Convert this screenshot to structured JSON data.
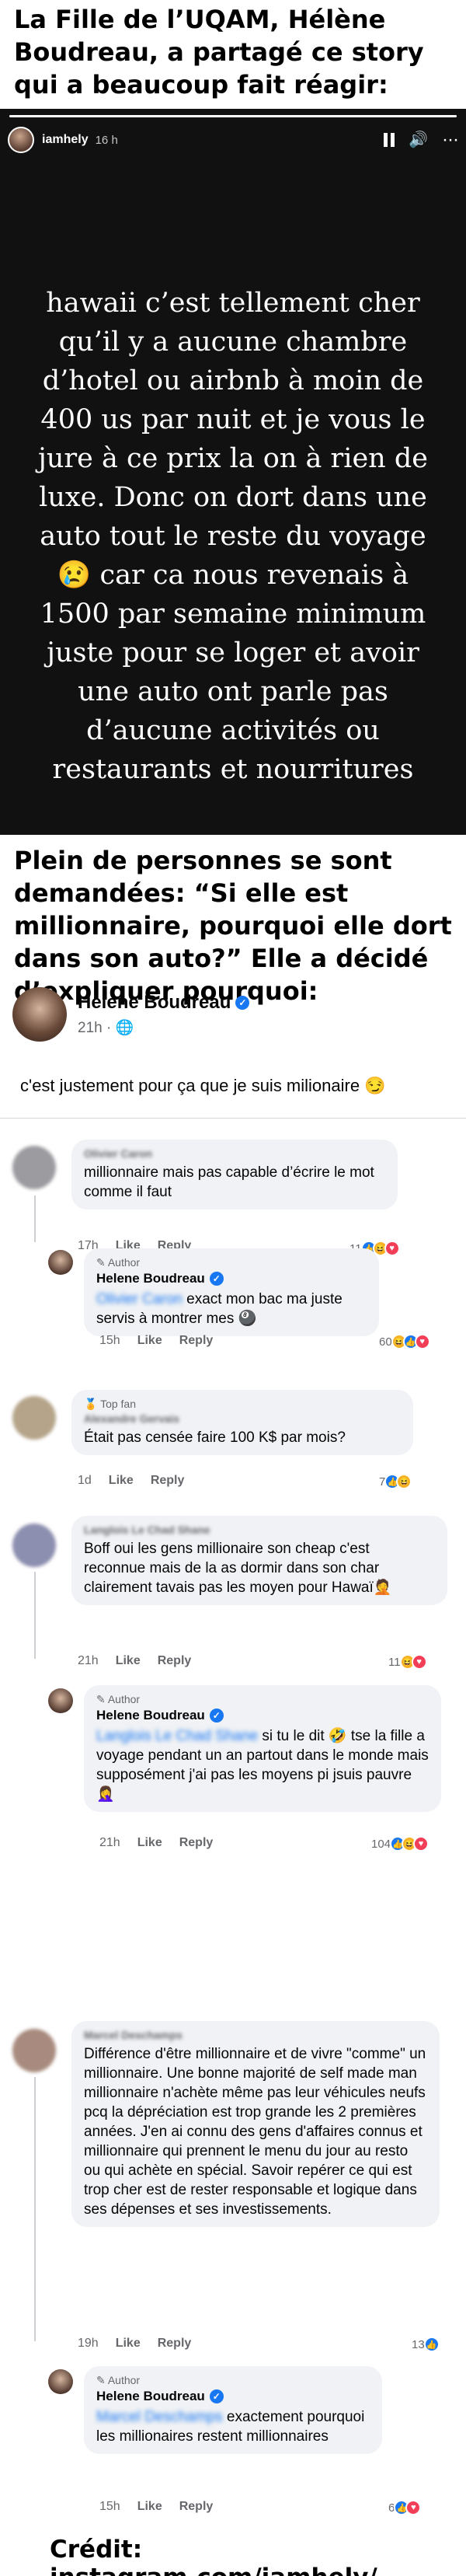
{
  "headline_top": "La Fille de l’UQAM, Hélène Boudreau, a partagé ce story qui a beaucoup fait réagir:",
  "story": {
    "username": "iamhely",
    "time": "16 h",
    "text": "hawaii c’est tellement cher qu’il y a aucune chambre d’hotel ou airbnb à moin de 400 us par nuit et je vous le jure à ce prix la on à rien de luxe. Donc on dort dans une auto tout le reste du voyage 😢 car ca nous revenais à 1500 par semaine minimum juste pour se loger et avoir une auto ont parle pas d’aucune activités ou restaurants et nourritures"
  },
  "headline_mid": "Plein de personnes se sont demandées: “Si elle est millionnaire, pourquoi elle dort dans son auto?” Elle a décidé d’expliquer pourquoi:",
  "post": {
    "author": "Helene Boudreau",
    "time": "21h",
    "separator": "·",
    "globe": "🌐",
    "text": "c'est justement pour ça que je suis milionaire 😏"
  },
  "labels": {
    "like": "Like",
    "reply": "Reply",
    "author_tag": "✎ Author",
    "top_fan": "🏅 Top fan"
  },
  "comments": [
    {
      "name": "Olivier Caron",
      "text": "millionnaire mais pas capable d’écrire le mot comme il faut",
      "time": "17h",
      "count": "11",
      "reply": {
        "name": "Helene Boudreau",
        "mention": "Olivier Caron",
        "text": "exact mon bac ma juste servis à montrer mes 🎱",
        "time": "15h",
        "count": "60"
      }
    },
    {
      "name": "Alexandre Gervais",
      "text": "Était pas censée faire 100 K$ par mois?",
      "time": "1d",
      "count": "7"
    },
    {
      "name": "Langlois Le Chad Shane",
      "text": "Boff oui les gens millionaire son cheap c'est reconnue mais de la as dormir dans son char clairement tavais pas les moyen pour Hawaï🤦",
      "time": "21h",
      "count": "11",
      "reply": {
        "name": "Helene Boudreau",
        "mention": "Langlois Le Chad Shane",
        "text": "si tu le dit 🤣 tse la fille a voyage pendant un an partout dans le monde mais supposément j'ai pas les moyens pi jsuis pauvre 🤦‍♀️",
        "time": "21h",
        "count": "104"
      }
    },
    {
      "name": "Marcel Deschamps",
      "text": "Différence d'être millionnaire et de vivre \"comme\" un millionnaire.  Une bonne majorité de self made man millionnaire n'achète même pas leur véhicules neufs pcq la dépréciation est trop grande les 2 premières années.  J'en ai connu des gens d'affaires connus et millionnaire qui prennent le menu du jour au resto ou qui achète en spécial. Savoir repérer ce qui est trop cher est de rester responsable et logique dans ses dépenses et ses investissements.",
      "time": "19h",
      "count": "13",
      "reply": {
        "name": "Helene Boudreau",
        "mention": "Marcel Deschamps",
        "text": "exactement pourquoi les millionaires restent millionnaires",
        "time": "15h",
        "count": "6"
      }
    }
  ],
  "credit": "Crédit: instagram.com/iamhely/"
}
